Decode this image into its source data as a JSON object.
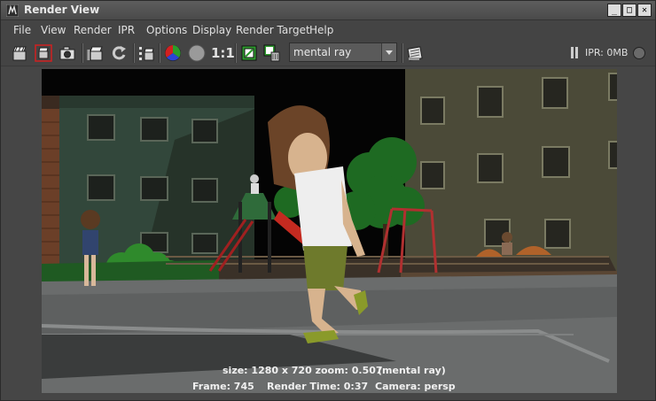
{
  "window": {
    "title": "Render View"
  },
  "menu": [
    "File",
    "View",
    "Render",
    "IPR",
    "Options",
    "Display",
    "Render Target",
    "Help"
  ],
  "toolbar": {
    "ratio_label": "1:1",
    "renderer": "mental ray",
    "ipr_status": "IPR: 0MB"
  },
  "render_info": {
    "size_line": "size: 1280 x 720 zoom: 0.507",
    "renderer_line": "(mental ray)",
    "frame": "Frame: 745",
    "render_time": "Render Time: 0:37",
    "camera": "Camera: persp"
  },
  "icons": [
    "clapper-icon",
    "clapper-region-icon",
    "snapshot-icon",
    "ipr-clapper-icon",
    "refresh-icon",
    "render-sequence-icon",
    "color-channels-icon",
    "alpha-channel-icon",
    "real-size-label",
    "keep-image-icon",
    "remove-image-icon",
    "renderer-dropdown",
    "render-settings-icon",
    "pause-icon",
    "ipr-indicator"
  ]
}
